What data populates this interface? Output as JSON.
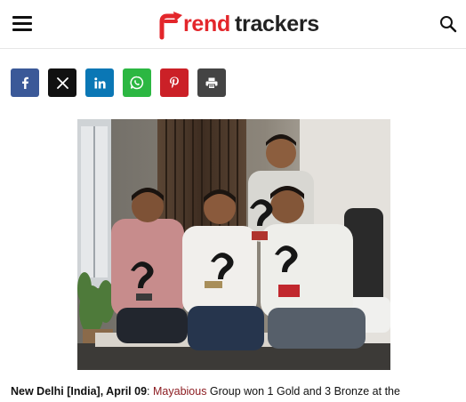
{
  "header": {
    "menu_icon": "hamburger-menu-icon",
    "logo": {
      "part1": "rend",
      "part2": "trackers",
      "brand_red": "#e3262b",
      "brand_dark": "#222222"
    },
    "search_icon": "search-icon"
  },
  "share": {
    "buttons": [
      {
        "name": "facebook",
        "icon": "facebook-icon",
        "color": "#3b5998"
      },
      {
        "name": "x",
        "icon": "x-icon",
        "color": "#111111"
      },
      {
        "name": "linkedin",
        "icon": "linkedin-icon",
        "color": "#0a77b5"
      },
      {
        "name": "whatsapp",
        "icon": "whatsapp-icon",
        "color": "#2cb742"
      },
      {
        "name": "pinterest",
        "icon": "pinterest-icon",
        "color": "#cb2027"
      },
      {
        "name": "print",
        "icon": "printer-icon",
        "color": "#444444"
      }
    ]
  },
  "article": {
    "dateline": "New Delhi [India], April 09",
    "separator": ": ",
    "company_link": "Mayabious",
    "lead_rest": " Group won 1 Gold and 3 Bronze at the"
  }
}
